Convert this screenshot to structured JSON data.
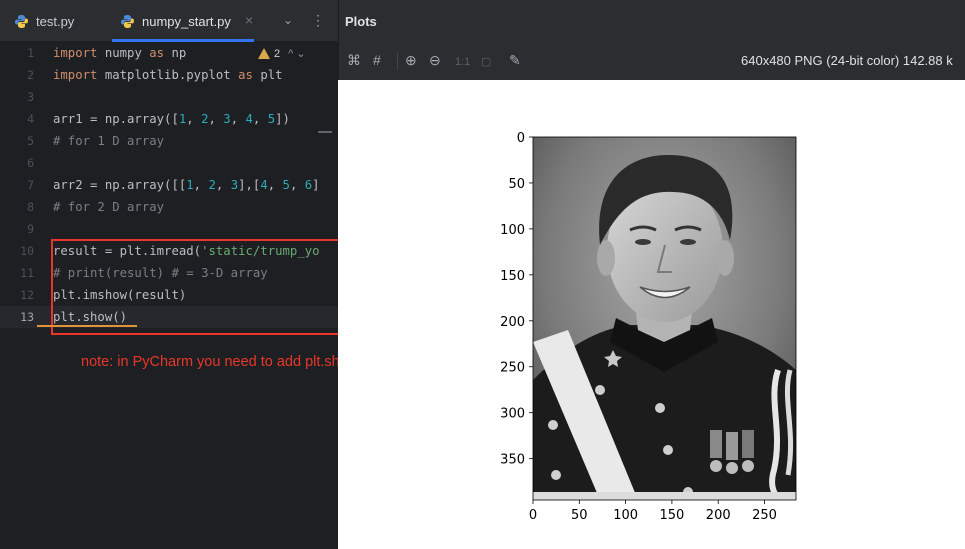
{
  "tabs": [
    {
      "label": "test.py"
    },
    {
      "label": "numpy_start.py",
      "active": true
    }
  ],
  "tab_close": "×",
  "tab_menu": "⌄",
  "tab_more": "⋮",
  "editor": {
    "warnings": {
      "count": "2",
      "nav": "^ ⌄"
    },
    "current_line": 13,
    "lines": [
      {
        "n": "1",
        "tokens": [
          [
            "kw",
            "import "
          ],
          [
            "fn",
            "numpy "
          ],
          [
            "kw",
            "as "
          ],
          [
            "fn",
            "np"
          ]
        ]
      },
      {
        "n": "2",
        "tokens": [
          [
            "kw",
            "import "
          ],
          [
            "fn",
            "matplotlib.pyplot "
          ],
          [
            "kw",
            "as "
          ],
          [
            "fn",
            "plt"
          ]
        ]
      },
      {
        "n": "3",
        "tokens": []
      },
      {
        "n": "4",
        "tokens": [
          [
            "fn",
            "arr1 = np.array(["
          ],
          [
            "num",
            "1"
          ],
          [
            "fn",
            ", "
          ],
          [
            "num",
            "2"
          ],
          [
            "fn",
            ", "
          ],
          [
            "num",
            "3"
          ],
          [
            "fn",
            ", "
          ],
          [
            "num",
            "4"
          ],
          [
            "fn",
            ", "
          ],
          [
            "num",
            "5"
          ],
          [
            "fn",
            "])"
          ]
        ]
      },
      {
        "n": "5",
        "tokens": [
          [
            "cmt",
            "# for 1 D array"
          ]
        ]
      },
      {
        "n": "6",
        "tokens": []
      },
      {
        "n": "7",
        "tokens": [
          [
            "fn",
            "arr2 = np.array([["
          ],
          [
            "num",
            "1"
          ],
          [
            "fn",
            ", "
          ],
          [
            "num",
            "2"
          ],
          [
            "fn",
            ", "
          ],
          [
            "num",
            "3"
          ],
          [
            "fn",
            "],["
          ],
          [
            "num",
            "4"
          ],
          [
            "fn",
            ", "
          ],
          [
            "num",
            "5"
          ],
          [
            "fn",
            ", "
          ],
          [
            "num",
            "6"
          ],
          [
            "fn",
            "]"
          ]
        ]
      },
      {
        "n": "8",
        "tokens": [
          [
            "cmt",
            "# for 2 D array"
          ]
        ]
      },
      {
        "n": "9",
        "tokens": []
      },
      {
        "n": "10",
        "tokens": [
          [
            "fn",
            "result = plt.imread("
          ],
          [
            "str",
            "'static/trump_yo"
          ]
        ]
      },
      {
        "n": "11",
        "tokens": [
          [
            "cmt",
            "# print(result) # = 3-D array"
          ]
        ]
      },
      {
        "n": "12",
        "tokens": [
          [
            "fn",
            "plt.imshow(result)"
          ]
        ]
      },
      {
        "n": "13",
        "tokens": [
          [
            "fn",
            "plt.show()"
          ]
        ]
      }
    ]
  },
  "annotation": {
    "note": "note: in PyCharm you need to add plt.show()"
  },
  "plots": {
    "title": "Plots",
    "toolbar": [
      {
        "icon": "fit-screen-icon",
        "glyph": "⌘"
      },
      {
        "icon": "grid-icon",
        "glyph": "#"
      },
      {
        "icon": "zoom-in-icon",
        "glyph": "⊕"
      },
      {
        "icon": "zoom-out-icon",
        "glyph": "⊖"
      },
      {
        "icon": "actual-size-icon",
        "glyph": "1:1"
      },
      {
        "icon": "fit-zoom-icon",
        "glyph": "▢"
      },
      {
        "icon": "color-picker-icon",
        "glyph": "✎"
      }
    ],
    "image_info": "640x480 PNG (24-bit color) 142.88 k"
  },
  "chart_data": {
    "type": "image",
    "x_ticks": [
      "0",
      "50",
      "100",
      "150",
      "200",
      "250"
    ],
    "y_ticks": [
      "0",
      "50",
      "100",
      "150",
      "200",
      "250",
      "300",
      "350"
    ],
    "xlim": [
      0,
      284
    ],
    "ylim": [
      395,
      0
    ]
  },
  "colors": {
    "accent": "#3574f0",
    "annotation_red": "#e8372a",
    "annotation_orange": "#e0943a"
  }
}
